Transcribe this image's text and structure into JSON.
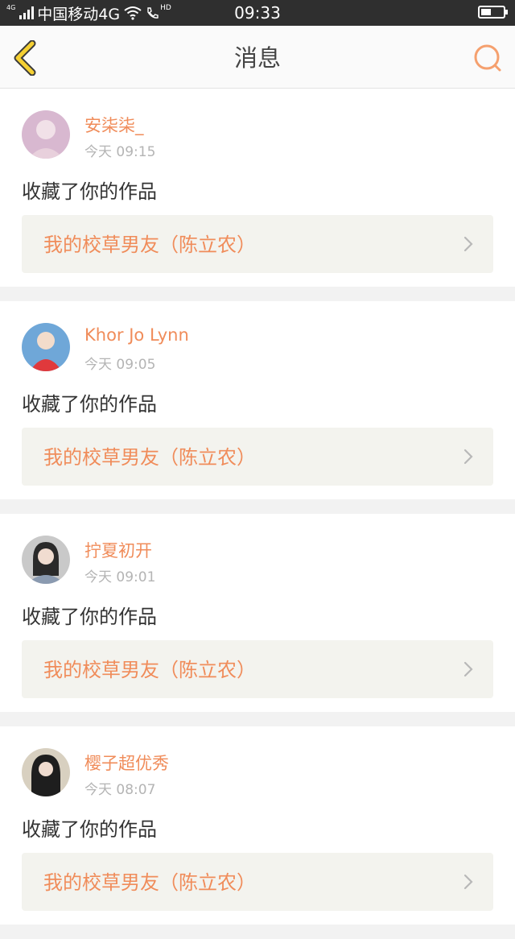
{
  "status_bar": {
    "network_tag": "4G",
    "carrier": "中国移动4G",
    "hd_label": "HD",
    "time": "09:33",
    "battery_level": 0.45
  },
  "header": {
    "title": "消息",
    "back_icon": "chevron-left-icon",
    "search_icon": "search-icon",
    "accent_color": "#f5d033",
    "search_color": "#f5a06e"
  },
  "messages": [
    {
      "user": "安柒柒_",
      "time": "今天 09:15",
      "action": "收藏了你的作品",
      "work": "我的校草男友（陈立农）",
      "avatar_color": "#d8b8d0"
    },
    {
      "user": "Khor Jo Lynn",
      "time": "今天 09:05",
      "action": "收藏了你的作品",
      "work": "我的校草男友（陈立农）",
      "avatar_color": "#6fa7d8"
    },
    {
      "user": "拧夏初开",
      "time": "今天 09:01",
      "action": "收藏了你的作品",
      "work": "我的校草男友（陈立农）",
      "avatar_color": "#c9c9c9"
    },
    {
      "user": "樱子超优秀",
      "time": "今天 08:07",
      "action": "收藏了你的作品",
      "work": "我的校草男友（陈立农）",
      "avatar_color": "#d8d0c0"
    }
  ]
}
